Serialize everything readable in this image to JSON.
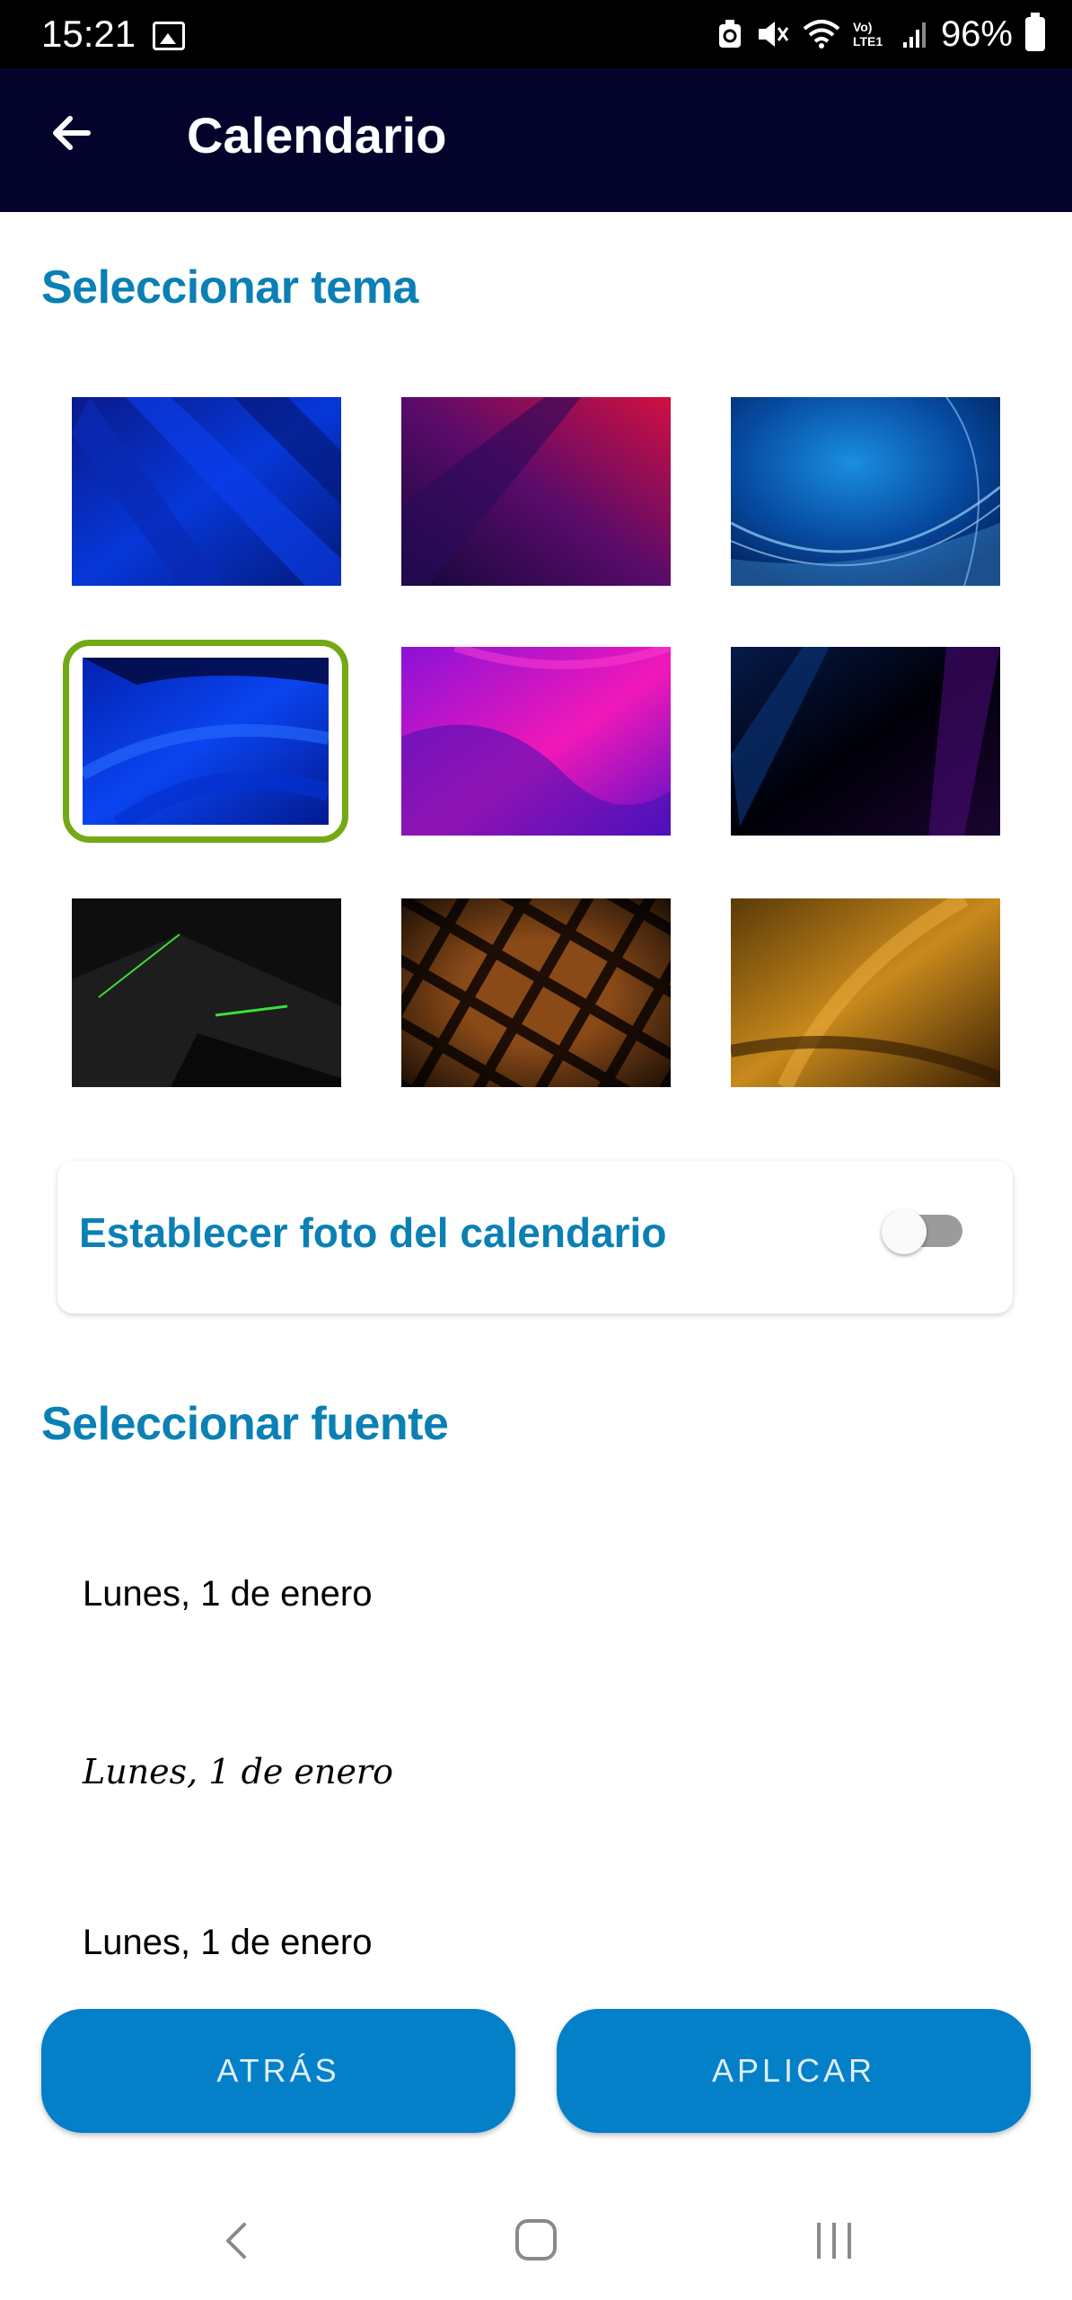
{
  "status_bar": {
    "time": "15:21",
    "signal_text": "Vo) LTE1",
    "battery": "96%",
    "icons": [
      "gallery-icon",
      "recycle-icon",
      "mute-icon",
      "wifi-icon",
      "signal-icon",
      "battery-icon"
    ]
  },
  "app_bar": {
    "title": "Calendario",
    "back_icon": "arrow-left-icon"
  },
  "theme_section": {
    "title": "Seleccionar tema",
    "selected_index": 3,
    "selected_color": "#72a914",
    "themes": [
      {
        "name": "blue-diagonal"
      },
      {
        "name": "purple-red"
      },
      {
        "name": "blue-waves"
      },
      {
        "name": "blue-curves"
      },
      {
        "name": "pink-waves"
      },
      {
        "name": "dark-purple"
      },
      {
        "name": "black-green"
      },
      {
        "name": "brown-weave"
      },
      {
        "name": "golden-silk"
      }
    ]
  },
  "calendar_photo": {
    "label": "Establecer foto del calendario",
    "enabled": false
  },
  "font_section": {
    "title": "Seleccionar fuente",
    "options": [
      {
        "text": "Lunes, 1 de enero",
        "style": "sans"
      },
      {
        "text": "Lunes, 1 de enero",
        "style": "script"
      },
      {
        "text": "Lunes, 1 de enero",
        "style": "sans"
      }
    ]
  },
  "buttons": {
    "back_label": "ATRÁS",
    "apply_label": "APLICAR"
  },
  "colors": {
    "app_bar": "#03032c",
    "accent_text": "#0a80b4",
    "button": "#0380c8"
  }
}
